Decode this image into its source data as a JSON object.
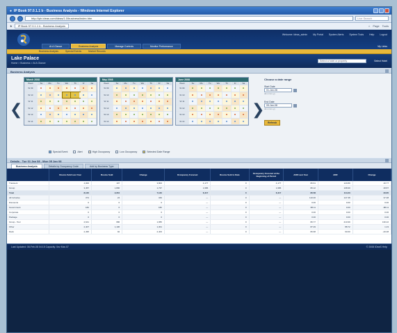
{
  "browser": {
    "title": "IP Book 97.0.1.1 b - Business Analysis - Windows Internet Explorer",
    "url": "http://ipb.ideas.com/ideas/1.0/business/index.htm",
    "search_placeholder": "Live Search",
    "tab_label": "IP Book 97.0.1.1 b - Business Analysis",
    "toolbar_items": [
      "Page",
      "Tools"
    ]
  },
  "header": {
    "toplinks": [
      "Welcome: ideas_admin",
      "My Portal",
      "System Alerts",
      "System Tools",
      "Help",
      "Logout"
    ],
    "nav_tabs": [
      {
        "label": "At A Glance",
        "active": false
      },
      {
        "label": "Business Analysis",
        "active": true
      },
      {
        "label": "Manage Controls",
        "active": false
      },
      {
        "label": "Monitor Performance",
        "active": false
      }
    ],
    "nav_right": "My Links",
    "subnav": [
      "Business Analysis",
      "Special Events",
      "Market Records"
    ]
  },
  "page": {
    "title": "Lake Palace",
    "breadcrumb": "Home > Business > At A Glance",
    "hotel_select": "Select a hotel or property",
    "hotel_link": "Select Hotel"
  },
  "analysis": {
    "panel_title": "Business Analysis",
    "months": [
      {
        "name": "March 2008"
      },
      {
        "name": "May 2008"
      },
      {
        "name": "June 2008"
      }
    ],
    "weekdays": [
      "Week",
      "Su",
      "Mo",
      "Tu",
      "We",
      "Th",
      "Fr",
      "Sa"
    ],
    "week_labels": [
      "W 09",
      "W 10",
      "W 11",
      "W 12",
      "W 13",
      "W 14"
    ],
    "legend": [
      "Special Event",
      "Alert",
      "High Occupancy",
      "Low Occupancy",
      "Selected Date Range"
    ],
    "date_range": {
      "title": "Choose a date range",
      "start_label": "Start Date",
      "start_value": "01-Jan-08",
      "start_hint": "dd-mmm-yy",
      "end_label": "End Date",
      "end_value": "05-Jan-08",
      "end_hint": "dd-mmm-yy",
      "submit": "Refresh"
    }
  },
  "details": {
    "title": "Details - Tue 01 Jan 08 - Mon 05 Jan 08",
    "tabs": [
      {
        "label": "Business Analysis",
        "active": true
      },
      {
        "label": "Details by Occupancy Code",
        "active": false
      },
      {
        "label": "Add by Business Type",
        "active": false
      }
    ],
    "columns": [
      "",
      "Rooms Sold Last Year",
      "Rooms Sold",
      "Change",
      "Occupancy Forecast",
      "Rooms Sold to Date",
      "Occupancy Forecast at the Beginning of Period",
      "ADR Last Year",
      "ADR",
      "Change"
    ],
    "rows": [
      {
        "seg": "Transient",
        "v": [
          "4,000",
          "197",
          "3,803",
          "4,177",
          "0",
          "4,177",
          "80.61",
          "120.89",
          "40.77"
        ]
      },
      {
        "seg": "Group",
        "v": [
          "3,457",
          "1,800",
          "1,737",
          "1,986",
          "0",
          "1,986",
          "80.12",
          "108.99",
          "28.87"
        ]
      },
      {
        "seg": "Total",
        "v": [
          "8,120",
          "2,210",
          "7,140",
          "6,417",
          "0",
          "6,417",
          "80.58",
          "114.23",
          "33.65"
        ],
        "total": true
      },
      {
        "seg": "All Inclusive",
        "v": [
          "374",
          "24",
          "349",
          "—",
          "0",
          "—",
          "110.00",
          "147.38",
          "37.38"
        ]
      },
      {
        "seg": "Discounts",
        "v": [
          "0",
          "0",
          "0",
          "—",
          "0",
          "—",
          "0.00",
          "0.00",
          "0.00"
        ]
      },
      {
        "seg": "Government",
        "v": [
          "182",
          "0",
          "182",
          "—",
          "0",
          "—",
          "88.11",
          "0.00",
          "-88.11"
        ]
      },
      {
        "seg": "Corporate",
        "v": [
          "0",
          "0",
          "0",
          "—",
          "0",
          "—",
          "0.00",
          "0.00",
          "0.00"
        ]
      },
      {
        "seg": "Package",
        "v": [
          "0",
          "0",
          "0",
          "—",
          "0",
          "—",
          "0.00",
          "0.00",
          "0.00"
        ]
      },
      {
        "seg": "Group - Tour",
        "v": [
          "2,641",
          "686",
          "1,955",
          "—",
          "0",
          "—",
          "80.77",
          "210.99",
          "130.22"
        ]
      },
      {
        "seg": "Other",
        "v": [
          "2,407",
          "1,106",
          "1,301",
          "—",
          "0",
          "—",
          "87.49",
          "88.72",
          "1.23"
        ]
      },
      {
        "seg": "Rack",
        "v": [
          "2,495",
          "92",
          "2,403",
          "—",
          "0",
          "—",
          "80.68",
          "60.60",
          "-20.08"
        ]
      }
    ]
  },
  "footer": {
    "left": "Last Updated: 08-Feb-08 04:15   Capacity: 0ez Mar-07",
    "right": "© 2008 IDeaS   Help"
  }
}
